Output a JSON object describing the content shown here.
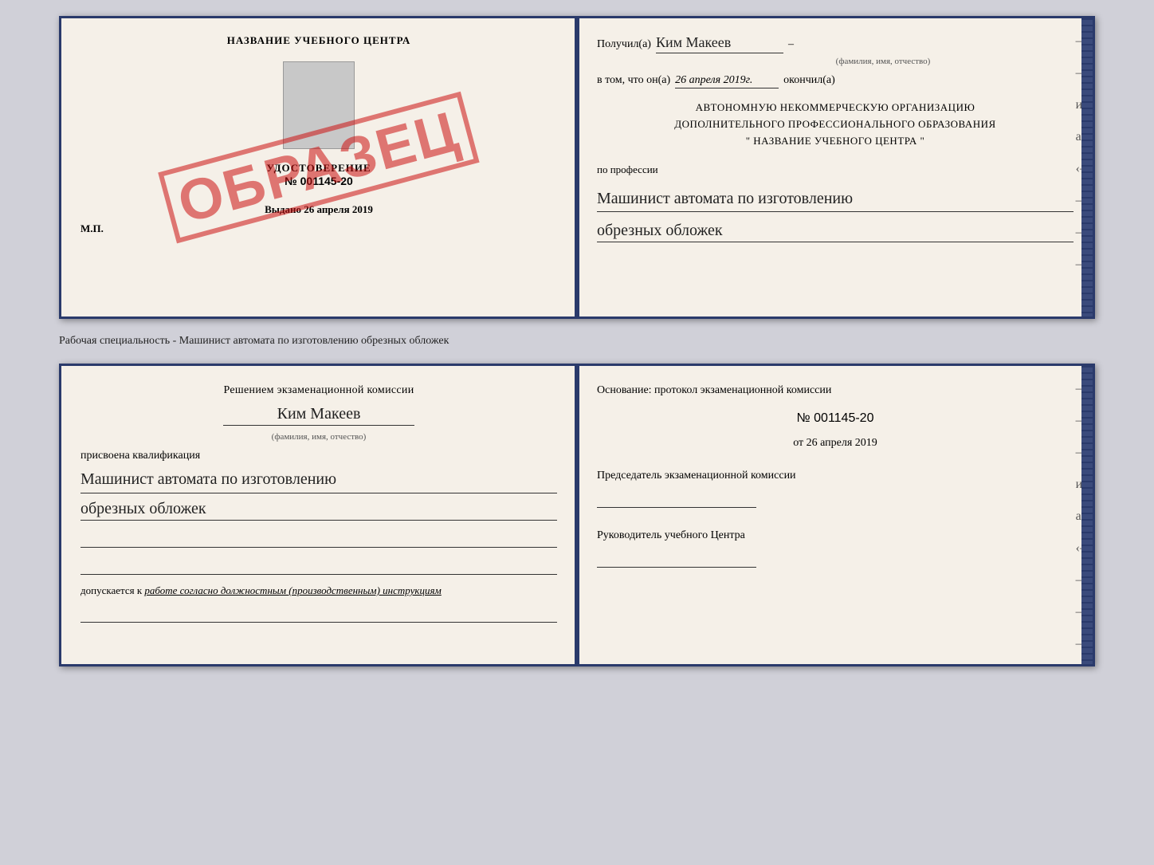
{
  "top_cert": {
    "left": {
      "title": "НАЗВАНИЕ УЧЕБНОГО ЦЕНТРА",
      "stamp": "ОБРАЗЕЦ",
      "udo_title": "УДОСТОВЕРЕНИЕ",
      "udo_number": "№ 001145-20",
      "vydano": "Выдано",
      "vydano_date": "26 апреля 2019",
      "mp": "М.П."
    },
    "right": {
      "poluchil": "Получил(а)",
      "name": "Ким Макеев",
      "fio_label": "(фамилия, имя, отчество)",
      "vtom_prefix": "в том, что он(а)",
      "date": "26 апреля 2019г.",
      "okonchil": "окончил(а)",
      "org_line1": "АВТОНОМНУЮ НЕКОММЕРЧЕСКУЮ ОРГАНИЗАЦИЮ",
      "org_line2": "ДОПОЛНИТЕЛЬНОГО ПРОФЕССИОНАЛЬНОГО ОБРАЗОВАНИЯ",
      "org_line3": "\" НАЗВАНИЕ УЧЕБНОГО ЦЕНТРА \"",
      "po_professii": "по профессии",
      "profession1": "Машинист автомата по изготовлению",
      "profession2": "обрезных обложек",
      "dash1": "–",
      "dash2": "–",
      "dash3": "–",
      "dash4": "и",
      "dash5": "а",
      "dash6": "‹–",
      "dash7": "–",
      "dash8": "–",
      "dash9": "–"
    }
  },
  "middle_label": "Рабочая специальность - Машинист автомата по изготовлению обрезных обложек",
  "bottom_cert": {
    "left": {
      "resheniyem": "Решением экзаменационной комиссии",
      "name": "Ким Макеев",
      "fio_label": "(фамилия, имя, отчество)",
      "prisvoena": "присвоена квалификация",
      "kval1": "Машинист автомата по изготовлению",
      "kval2": "обрезных обложек",
      "dopuskaetsya": "допускается к",
      "dopuskaetsya_cursive": "работе согласно должностным (производственным) инструкциям"
    },
    "right": {
      "osnovanie": "Основание: протокол экзаменационной комиссии",
      "protocol_number": "№ 001145-20",
      "ot_label": "от",
      "protocol_date": "26 апреля 2019",
      "predsedatel_title": "Председатель экзаменационной комиссии",
      "rukovoditel_title": "Руководитель учебного Центра",
      "dash1": "–",
      "dash2": "–",
      "dash3": "–",
      "dash4": "и",
      "dash5": "а",
      "dash6": "‹–",
      "dash7": "–",
      "dash8": "–",
      "dash9": "–"
    }
  }
}
